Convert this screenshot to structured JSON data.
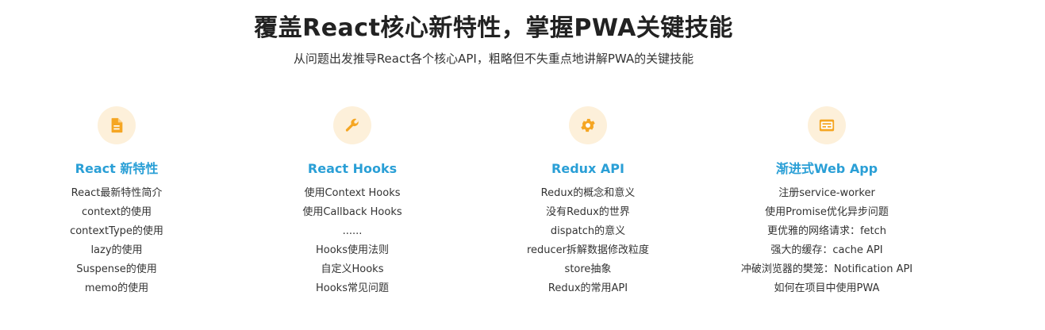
{
  "header": {
    "title": "覆盖React核心新特性，掌握PWA关键技能",
    "subtitle": "从问题出发推导React各个核心API，粗略但不失重点地讲解PWA的关键技能"
  },
  "colors": {
    "accent": "#2a9fd6",
    "icon": "#f5a623",
    "icon_bg": "#fdf0da"
  },
  "features": [
    {
      "icon": "document-icon",
      "title": "React 新特性",
      "items": [
        "React最新特性简介",
        "context的使用",
        "contextType的使用",
        "lazy的使用",
        "Suspense的使用",
        "memo的使用"
      ]
    },
    {
      "icon": "wrench-icon",
      "title": "React Hooks",
      "items": [
        "使用Context Hooks",
        "使用Callback Hooks",
        "......",
        "Hooks使用法则",
        "自定义Hooks",
        "Hooks常见问题"
      ]
    },
    {
      "icon": "gear-icon",
      "title": "Redux API",
      "items": [
        "Redux的概念和意义",
        "没有Redux的世界",
        "dispatch的意义",
        "reducer拆解数据修改粒度",
        "store抽象",
        "Redux的常用API"
      ]
    },
    {
      "icon": "web-app-icon",
      "title": "渐进式Web App",
      "items": [
        "注册service-worker",
        "使用Promise优化异步问题",
        "更优雅的网络请求：fetch",
        "强大的缓存：cache API",
        "冲破浏览器的樊笼：Notification API",
        "如何在项目中使用PWA"
      ]
    }
  ]
}
